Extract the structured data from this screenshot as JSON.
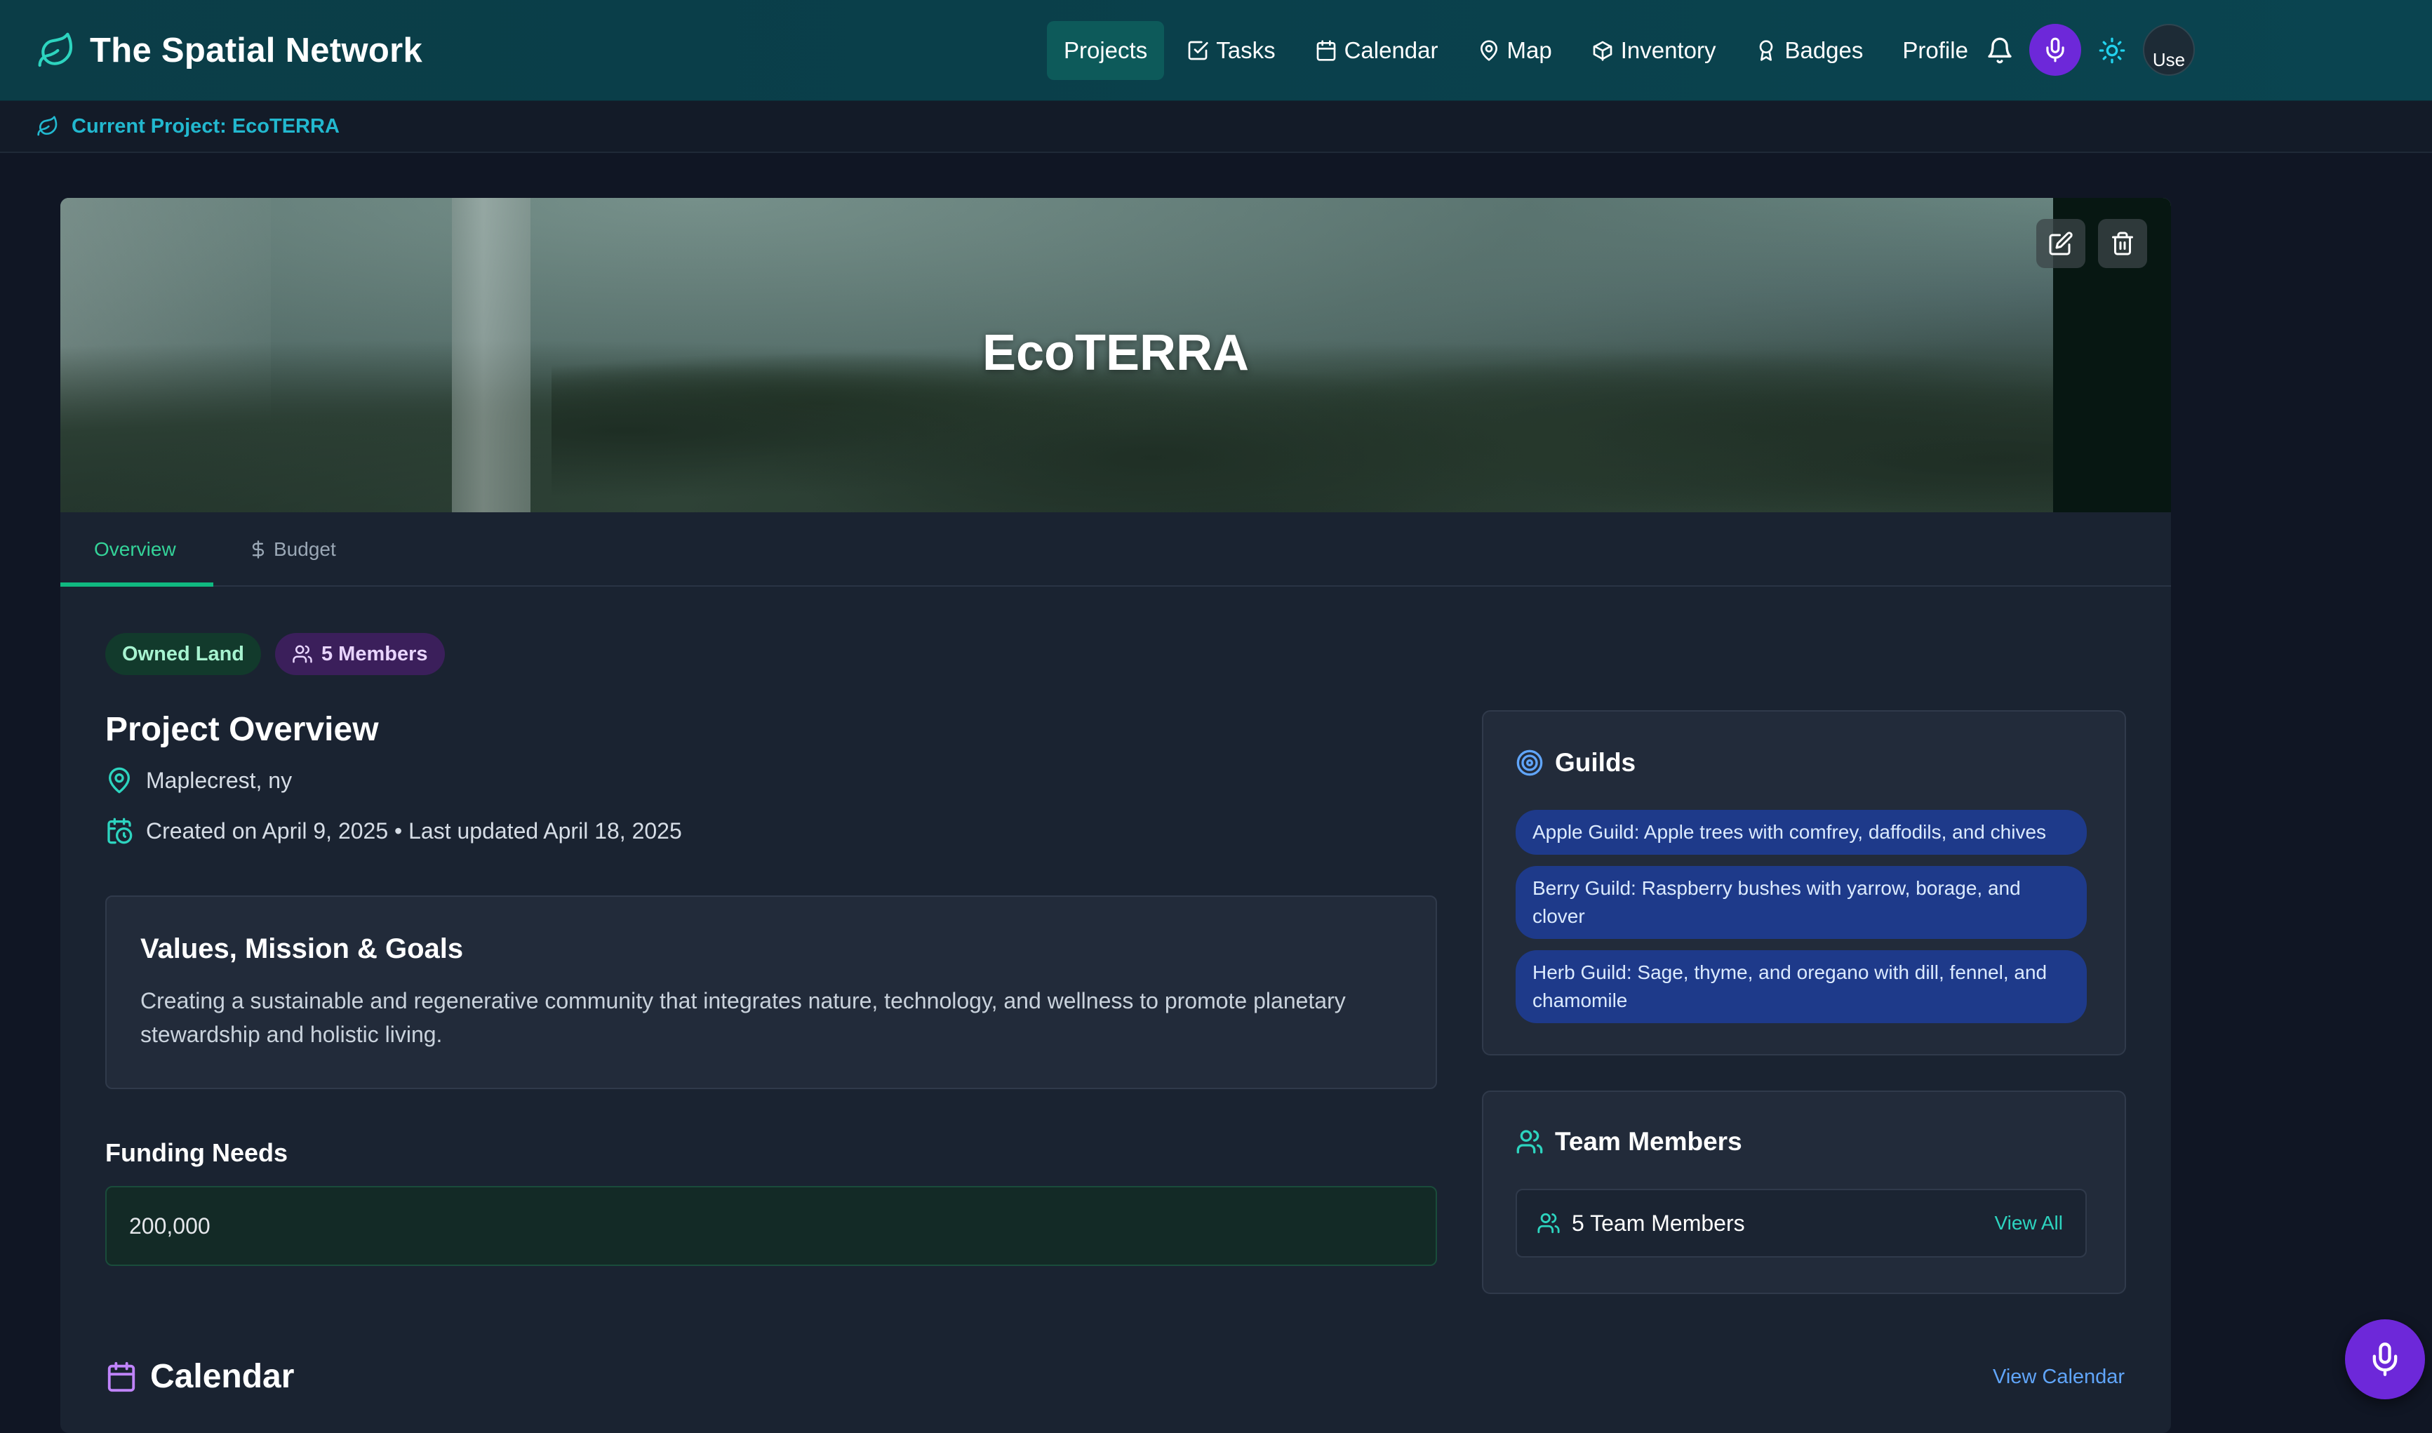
{
  "app": {
    "name": "The Spatial Network"
  },
  "nav": {
    "items": [
      {
        "label": "Projects",
        "icon": "",
        "active": true
      },
      {
        "label": "Tasks",
        "icon": "check-square-icon"
      },
      {
        "label": "Calendar",
        "icon": "calendar-icon"
      },
      {
        "label": "Map",
        "icon": "map-pin-icon"
      },
      {
        "label": "Inventory",
        "icon": "box-icon"
      },
      {
        "label": "Badges",
        "icon": "award-icon"
      },
      {
        "label": "Profile",
        "icon": ""
      }
    ],
    "avatar_alt": "Use"
  },
  "breadcrumb": {
    "text": "Current Project: EcoTERRA"
  },
  "project": {
    "title": "EcoTERRA",
    "tabs": [
      {
        "label": "Overview",
        "active": true
      },
      {
        "label": "Budget",
        "icon": "dollar-icon"
      }
    ],
    "badges": {
      "land": "Owned Land",
      "members": "5 Members"
    },
    "overview_heading": "Project Overview",
    "location": "Maplecrest, ny",
    "dates": "Created on April 9, 2025 • Last updated April 18, 2025",
    "values": {
      "heading": "Values, Mission & Goals",
      "text": "Creating a sustainable and regenerative community that integrates nature, technology, and wellness to promote planetary stewardship and holistic living."
    },
    "funding": {
      "label": "Funding Needs",
      "value": "200,000"
    }
  },
  "guilds": {
    "title": "Guilds",
    "items": [
      "Apple Guild: Apple trees with comfrey, daffodils, and chives",
      "Berry Guild: Raspberry bushes with yarrow, borage, and clover",
      "Herb Guild: Sage, thyme, and oregano with dill, fennel, and chamomile"
    ]
  },
  "team": {
    "title": "Team Members",
    "count_label": "5 Team Members",
    "view_all": "View All"
  },
  "calendar": {
    "title": "Calendar",
    "view_link": "View Calendar"
  },
  "colors": {
    "accent_green": "#10b981",
    "accent_teal": "#2dd4bf",
    "purple": "#6d28d9",
    "blue_link": "#60a5fa"
  }
}
